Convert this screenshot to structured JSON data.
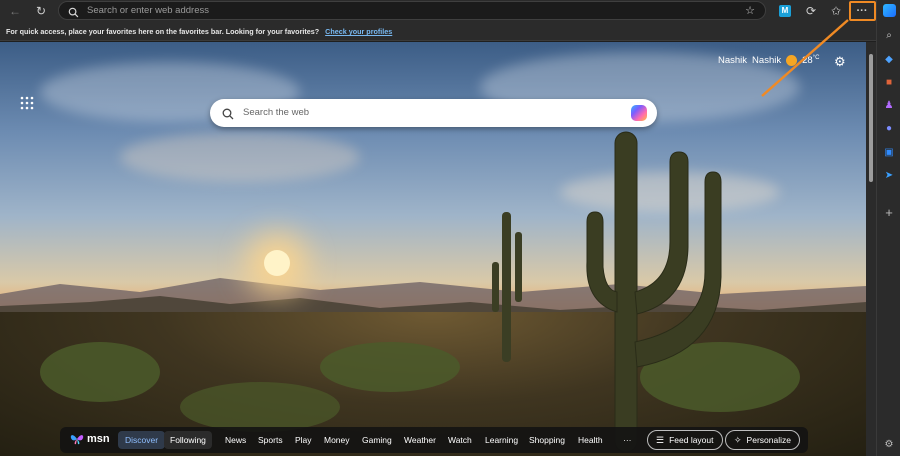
{
  "address_bar": {
    "placeholder": "Search or enter web address"
  },
  "favorites_bar": {
    "message": "For quick access, place your favorites here on the favorites bar. Looking for your favorites?",
    "link": "Check your profiles"
  },
  "toolbar": {
    "more_label": "···"
  },
  "weather": {
    "city": "Nashik",
    "city2": "Nashik",
    "temp": "28",
    "unit": "°C"
  },
  "search": {
    "placeholder": "Search the web"
  },
  "msn": {
    "logo": "msn",
    "tabs": [
      "Discover",
      "Following"
    ],
    "nav": [
      "News",
      "Sports",
      "Play",
      "Money",
      "Gaming",
      "Weather",
      "Watch",
      "Learning",
      "Shopping",
      "Health"
    ],
    "more": "···",
    "feed_layout": "Feed layout",
    "personalize": "Personalize"
  },
  "colors": {
    "accent": "#f08a24",
    "link": "#78b8f0",
    "discover": "#8fbfff"
  }
}
